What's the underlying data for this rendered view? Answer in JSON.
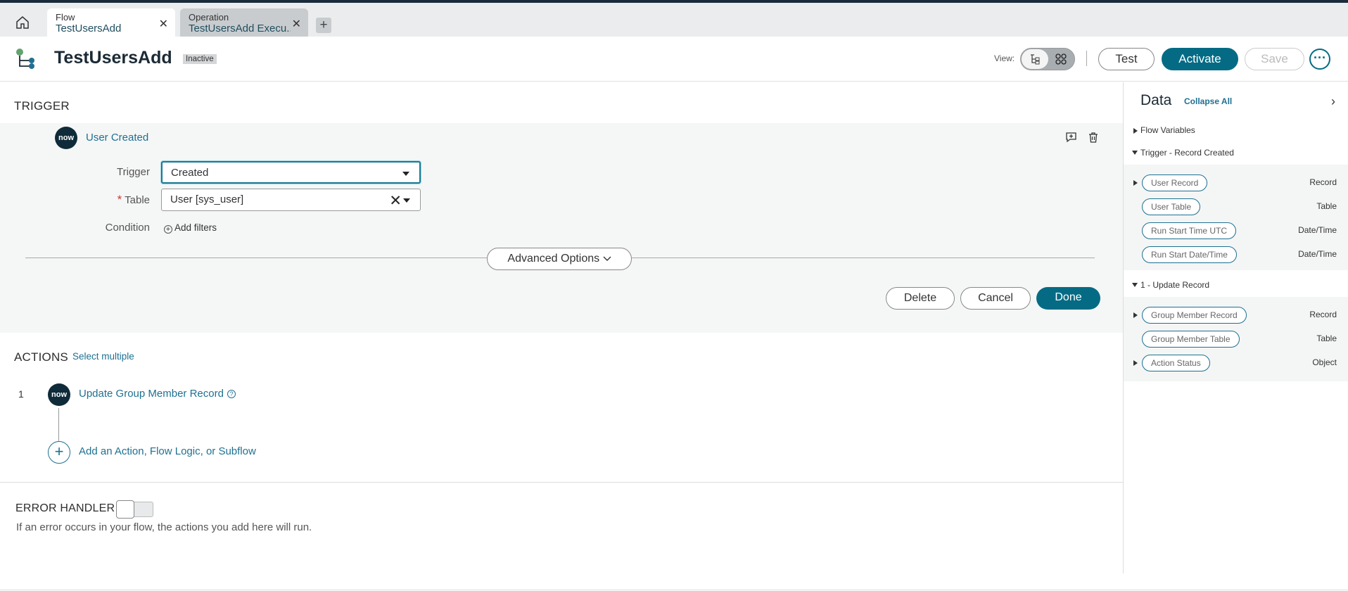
{
  "tabs": [
    {
      "label": "Flow",
      "name": "TestUsersAdd"
    },
    {
      "label": "Operation",
      "name": "TestUsersAdd Execu..."
    }
  ],
  "header": {
    "title": "TestUsersAdd",
    "status": "Inactive",
    "view_label": "View:",
    "test_label": "Test",
    "activate_label": "Activate",
    "save_label": "Save",
    "more_label": "···"
  },
  "trigger": {
    "section_title": "TRIGGER",
    "icon_text": "now",
    "name": "User Created",
    "trigger_label": "Trigger",
    "trigger_value": "Created",
    "required_mark": "*",
    "table_label": "Table",
    "table_value": "User [sys_user]",
    "condition_label": "Condition",
    "add_filters": "Add filters",
    "advanced_options": "Advanced Options",
    "delete_label": "Delete",
    "cancel_label": "Cancel",
    "done_label": "Done"
  },
  "actions": {
    "section_title": "ACTIONS",
    "select_multiple": "Select multiple",
    "items": [
      {
        "number": "1",
        "icon_text": "now",
        "name": "Update Group Member Record"
      }
    ],
    "add_action": "Add an Action, Flow Logic, or Subflow"
  },
  "error_handler": {
    "title": "ERROR HANDLER",
    "description": "If an error occurs in your flow, the actions you add here will run."
  },
  "data_panel": {
    "title": "Data",
    "collapse_all": "Collapse All",
    "flow_variables": "Flow Variables",
    "group1": {
      "title": "Trigger - Record Created",
      "items": [
        {
          "label": "User Record",
          "type": "Record"
        },
        {
          "label": "User Table",
          "type": "Table"
        },
        {
          "label": "Run Start Time UTC",
          "type": "Date/Time"
        },
        {
          "label": "Run Start Date/Time",
          "type": "Date/Time"
        }
      ]
    },
    "group2": {
      "title": "1 - Update Record",
      "items": [
        {
          "label": "Group Member Record",
          "type": "Record"
        },
        {
          "label": "Group Member Table",
          "type": "Table"
        },
        {
          "label": "Action Status",
          "type": "Object"
        }
      ]
    }
  },
  "colors": {
    "accent": "#056b84",
    "link": "#1e7091",
    "dark": "#0f2b3a"
  }
}
